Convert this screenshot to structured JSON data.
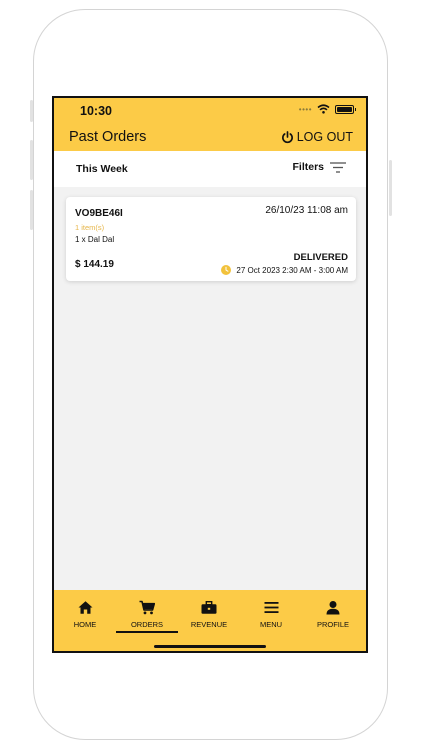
{
  "status_bar": {
    "time": "10:30"
  },
  "header": {
    "title": "Past Orders",
    "logout_label": "LOG OUT"
  },
  "filter_bar": {
    "period_label": "This Week",
    "filters_label": "Filters"
  },
  "orders": [
    {
      "id": "VO9BE46I",
      "date": "26/10/23 11:08 am",
      "items_count": "1 item(s)",
      "items_text": "1 x Dal Dal",
      "total": "$ 144.19",
      "status": "DELIVERED",
      "slot": "27 Oct 2023 2:30 AM - 3:00 AM"
    }
  ],
  "nav": {
    "items": [
      {
        "label": "HOME",
        "icon": "home-icon"
      },
      {
        "label": "ORDERS",
        "icon": "cart-icon"
      },
      {
        "label": "REVENUE",
        "icon": "briefcase-icon"
      },
      {
        "label": "MENU",
        "icon": "menu-icon"
      },
      {
        "label": "PROFILE",
        "icon": "user-icon"
      }
    ],
    "active": "ORDERS"
  },
  "colors": {
    "accent": "#fccb47",
    "highlight_text": "#e6b64a",
    "background": "#f2f2f2"
  }
}
